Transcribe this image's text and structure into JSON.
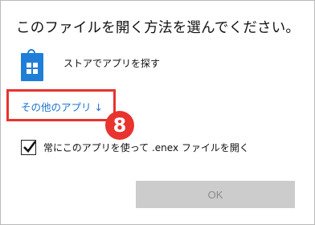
{
  "dialog": {
    "title": "このファイルを開く方法を選んでください。",
    "store_option": {
      "label": "ストアでアプリを探す",
      "icon": "store-bag-icon"
    },
    "other_apps_link": "その他のアプリ ↓",
    "always_use_checkbox": {
      "checked": true,
      "label": "常にこのアプリを使って .enex ファイルを開く"
    },
    "ok_button": "OK"
  },
  "annotation": {
    "step_number": "8",
    "color": "#e8332e"
  },
  "colors": {
    "link": "#1a73d0",
    "store_icon": "#1f7fd8",
    "button_disabled_bg": "#cccccc"
  }
}
